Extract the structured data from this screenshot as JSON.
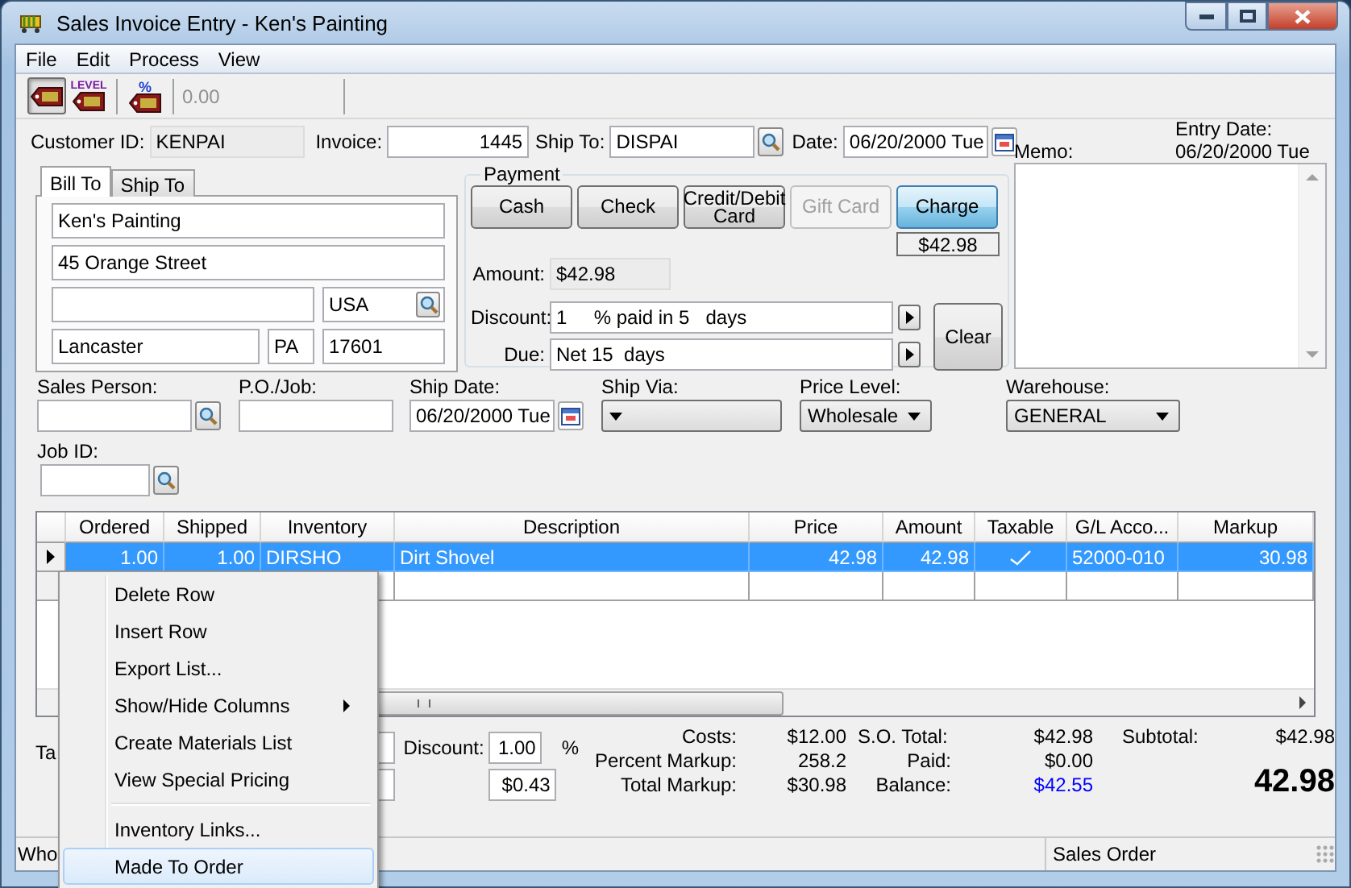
{
  "window": {
    "title": "Sales Invoice Entry - Ken's Painting"
  },
  "menu_bar": [
    "File",
    "Edit",
    "Process",
    "View"
  ],
  "toolbar": {
    "buttons": [
      {
        "selected": true
      },
      {
        "selected": false,
        "label": "LEVEL"
      },
      {
        "selected": false,
        "label": "%"
      }
    ],
    "amount": "0.00"
  },
  "header": {
    "customer_id": {
      "label": "Customer ID:",
      "value": "KENPAI"
    },
    "invoice": {
      "label": "Invoice:",
      "value": "1445"
    },
    "ship_to": {
      "label": "Ship To:",
      "value": "DISPAI"
    },
    "date": {
      "label": "Date:",
      "value": "06/20/2000 Tue"
    }
  },
  "memo": {
    "label": "Memo:",
    "entry_date_label": "Entry Date:",
    "entry_date": "06/20/2000 Tue"
  },
  "address_tabs": [
    {
      "label": "Bill To",
      "selected": true
    },
    {
      "label": "Ship To",
      "selected": false
    }
  ],
  "address": {
    "name": "Ken's Painting",
    "street": "45 Orange Street",
    "country": "USA",
    "city": "Lancaster",
    "state": "PA",
    "zip": "17601"
  },
  "payment": {
    "title": "Payment",
    "methods": [
      {
        "label": "Cash",
        "selected": false,
        "disabled": false
      },
      {
        "label": "Check",
        "selected": false,
        "disabled": false
      },
      {
        "label": "Credit/Debit Card",
        "selected": false,
        "disabled": false
      },
      {
        "label": "Gift Card",
        "selected": false,
        "disabled": true
      },
      {
        "label": "Charge",
        "selected": true,
        "disabled": false
      }
    ],
    "charge_amount": "$42.98",
    "amount": {
      "label": "Amount:",
      "value": "$42.98"
    },
    "discount": {
      "label": "Discount:",
      "value": "1     % paid in 5   days"
    },
    "due": {
      "label": "Due:",
      "value": "Net 15  days"
    },
    "clear_button": "Clear"
  },
  "order_fields": [
    {
      "label": "Sales Person:",
      "kind": "lookup"
    },
    {
      "label": "P.O./Job:",
      "kind": "text"
    },
    {
      "label": "Ship Date:",
      "kind": "date",
      "value": "06/20/2000 Tue"
    },
    {
      "label": "Ship Via:",
      "kind": "dropdown"
    },
    {
      "label": "Price Level:",
      "kind": "dropdown",
      "value": "Wholesale"
    },
    {
      "label": "Warehouse:",
      "kind": "dropdown",
      "value": "GENERAL"
    }
  ],
  "job_id": {
    "label": "Job ID:",
    "kind": "lookup"
  },
  "table": {
    "columns": [
      "Ordered",
      "Shipped",
      "Inventory",
      "Description",
      "Price",
      "Amount",
      "Taxable",
      "G/L Acco...",
      "Markup"
    ],
    "rows": [
      {
        "selected": true,
        "ordered": "1.00",
        "shipped": "1.00",
        "inventory": "DIRSHO",
        "description": "Dirt Shovel",
        "price": "42.98",
        "amount": "42.98",
        "taxable": true,
        "gl_account": "52000-010",
        "markup": "30.98"
      }
    ]
  },
  "totals": {
    "tax_label": "Ta",
    "discount": {
      "label": "Discount:",
      "value": "1.00",
      "unit": "%"
    },
    "discount_amount": "$0.43",
    "costs": [
      {
        "label": "Costs:",
        "value": "$12.00"
      },
      {
        "label": "Percent Markup:",
        "value": "258.2"
      },
      {
        "label": "Total Markup:",
        "value": "$30.98"
      }
    ],
    "order": [
      {
        "label": "S.O. Total:",
        "value": "$42.98",
        "highlighted": false
      },
      {
        "label": "Paid:",
        "value": "$0.00",
        "highlighted": false
      },
      {
        "label": "Balance:",
        "value": "$42.55",
        "highlighted": true
      }
    ],
    "subtotal": {
      "label": "Subtotal:",
      "value": "$42.98"
    },
    "total": "42.98"
  },
  "status_bar": [
    "Who",
    "Sales Order"
  ],
  "context_menu": {
    "items": [
      {
        "kind": "item",
        "label": "Delete Row",
        "submenu": false,
        "hovered": false
      },
      {
        "kind": "item",
        "label": "Insert Row",
        "submenu": false,
        "hovered": false
      },
      {
        "kind": "item",
        "label": "Export List...",
        "submenu": false,
        "hovered": false
      },
      {
        "kind": "item",
        "label": "Show/Hide Columns",
        "submenu": true,
        "hovered": false
      },
      {
        "kind": "item",
        "label": "Create Materials List",
        "submenu": false,
        "hovered": false
      },
      {
        "kind": "item",
        "label": "View Special Pricing",
        "submenu": false,
        "hovered": false
      },
      {
        "kind": "separator"
      },
      {
        "kind": "item",
        "label": "Inventory Links...",
        "submenu": false,
        "hovered": false
      },
      {
        "kind": "item",
        "label": "Made To Order",
        "submenu": false,
        "hovered": true
      }
    ]
  }
}
